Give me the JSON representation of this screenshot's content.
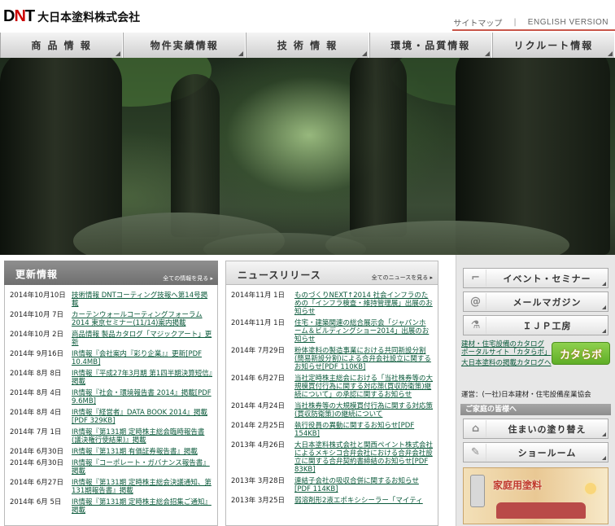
{
  "header": {
    "logo_mark_a": "D",
    "logo_mark_b": "N",
    "logo_mark_c": "T",
    "company_name": "大日本塗料株式会社",
    "sitemap": "サイトマップ",
    "separator": "|",
    "english": "ENGLISH VERSION"
  },
  "nav": [
    {
      "label": "商 品 情 報"
    },
    {
      "label": "物件実績情報"
    },
    {
      "label": "技 術 情 報"
    },
    {
      "label": "環境・品質情報"
    },
    {
      "label": "リクルート情報"
    }
  ],
  "updates": {
    "title": "更新情報",
    "more": "全ての情報を見る",
    "items": [
      {
        "date": "2014年10月10日",
        "title": "技術情報 DNTコーティング技報へ第14号掲載"
      },
      {
        "date": "2014年10月 7日",
        "title": "カーテンウォールコーティングフォーラム2014 東京セミナー(11/14)案内掲載"
      },
      {
        "date": "2014年10月 2日",
        "title": "商品情報 製品カタログ「マジックアート」更新"
      },
      {
        "date": "2014年 9月16日",
        "title": "IR情報『会社案内『彩り企業』』更新[PDF 10.4MB]"
      },
      {
        "date": "2014年 8月 8日",
        "title": "IR情報『平成27年3月期 第1四半期決算短信』掲載"
      },
      {
        "date": "2014年 8月 4日",
        "title": "IR情報『社会・環境報告書 2014』掲載[PDF 9.6MB]"
      },
      {
        "date": "2014年 8月 4日",
        "title": "IR情報『経営者』DATA BOOK 2014』掲載[PDF 329KB]"
      },
      {
        "date": "2014年 7月 1日",
        "title": "IR情報『第131期 定時株主総会臨時報告書(議決権行使結果)』掲載"
      },
      {
        "date": "2014年 6月30日",
        "title": "IR情報『第131期 有価証券報告書』掲載"
      },
      {
        "date": "2014年 6月30日",
        "title": "IR情報『コーポレート・ガバナンス報告書』掲載"
      },
      {
        "date": "2014年 6月27日",
        "title": "IR情報『第131期 定時株主総会決議通知、第131期報告書』掲載"
      },
      {
        "date": "2014年 6月 5日",
        "title": "IR情報『第131期 定時株主総会招集ご通知』掲載"
      }
    ]
  },
  "news": {
    "title": "ニュースリリース",
    "more": "全てのニュースを見る",
    "items": [
      {
        "date": "2014年11月 1日",
        "title": "ものづくりNEXT↑2014 社会インフラのための「インフラ検査・維持管理展」出展のお知らせ"
      },
      {
        "date": "2014年11月 1日",
        "title": "住宅・建築関連の総合展示会「ジャパンホーム＆ビルディングショー2014」出展のお知らせ"
      },
      {
        "date": "2014年 7月29日",
        "title": "粉体塗料の製造事業における共同新設分割(簡易新設分割)による合弁会社設立に関するお知らせ[PDF 110KB]"
      },
      {
        "date": "2014年 6月27日",
        "title": "当社定時株主総会における「当社株券等の大規模買付行為に関する対応策(買収防衛策)継続について」の承認に関するお知らせ"
      },
      {
        "date": "2014年 4月24日",
        "title": "当社株券等の大規模買付行為に関する対応策(買収防衛策)の継続について"
      },
      {
        "date": "2014年 2月25日",
        "title": "執行役員の異動に関するお知らせ[PDF 154KB]"
      },
      {
        "date": "2013年 4月26日",
        "title": "大日本塗料株式会社と関西ペイント株式会社によるメキシコ合弁会社における合弁会社設立に関する合弁契約書締結のお知らせ[PDF 83KB]"
      },
      {
        "date": "2013年 3月28日",
        "title": "連結子会社の吸収合併に関するお知らせ[PDF 114KB]"
      },
      {
        "date": "2013年 3月25日",
        "title": "弱溶剤形2液エポキシシーラー「マイティ"
      }
    ]
  },
  "side": {
    "buttons": [
      {
        "label": "イベント・セミナー",
        "icon": "chair-icon",
        "glyph": "⌐"
      },
      {
        "label": "メールマガジン",
        "icon": "mail-icon",
        "glyph": "@"
      },
      {
        "label": "ＩＪＰ工房",
        "icon": "lab-flask-icon",
        "glyph": "⚗"
      }
    ],
    "katalog_text": "建材・住宅設備のカタログポータルサイト「カタらボ」",
    "katalog_badge": "カタらボ",
    "katalog_link": "大日本塗料の掲載カタログへ",
    "operator": "運営：(一社)日本建材・住宅設備産業協会",
    "home_head": "ご家庭の皆様へ",
    "home_buttons": [
      {
        "label": "住まいの塗り替え",
        "icon": "house-icon",
        "glyph": "⌂"
      },
      {
        "label": "ショールーム",
        "icon": "paint-tube-icon",
        "glyph": "✎"
      }
    ],
    "banner_text": "家庭用塗料"
  }
}
